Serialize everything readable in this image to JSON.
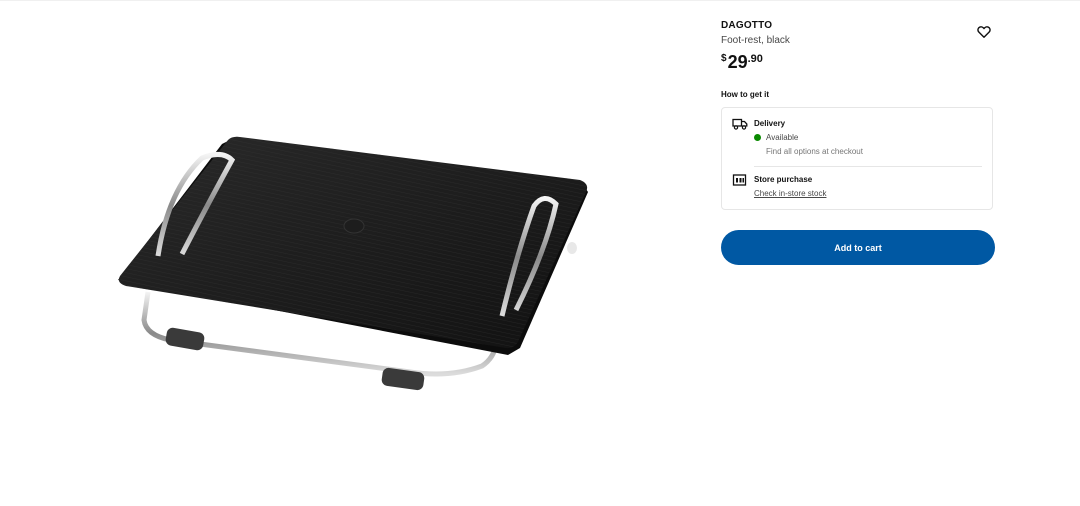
{
  "product": {
    "name": "DAGOTTO",
    "description": "Foot-rest, black",
    "price": {
      "currency": "$",
      "integer": "29",
      "decimal": ".90"
    },
    "image_alt": "foot-rest-image"
  },
  "favorite": {
    "icon": "heart-icon"
  },
  "availability": {
    "heading": "How to get it",
    "delivery": {
      "icon": "truck-icon",
      "title": "Delivery",
      "status": "Available",
      "status_color": "#0a8a00",
      "note": "Find all options at checkout"
    },
    "store": {
      "icon": "store-icon",
      "title": "Store purchase",
      "link": "Check in-store stock"
    }
  },
  "actions": {
    "add_to_cart": "Add to cart",
    "accent": "#0058a3"
  }
}
